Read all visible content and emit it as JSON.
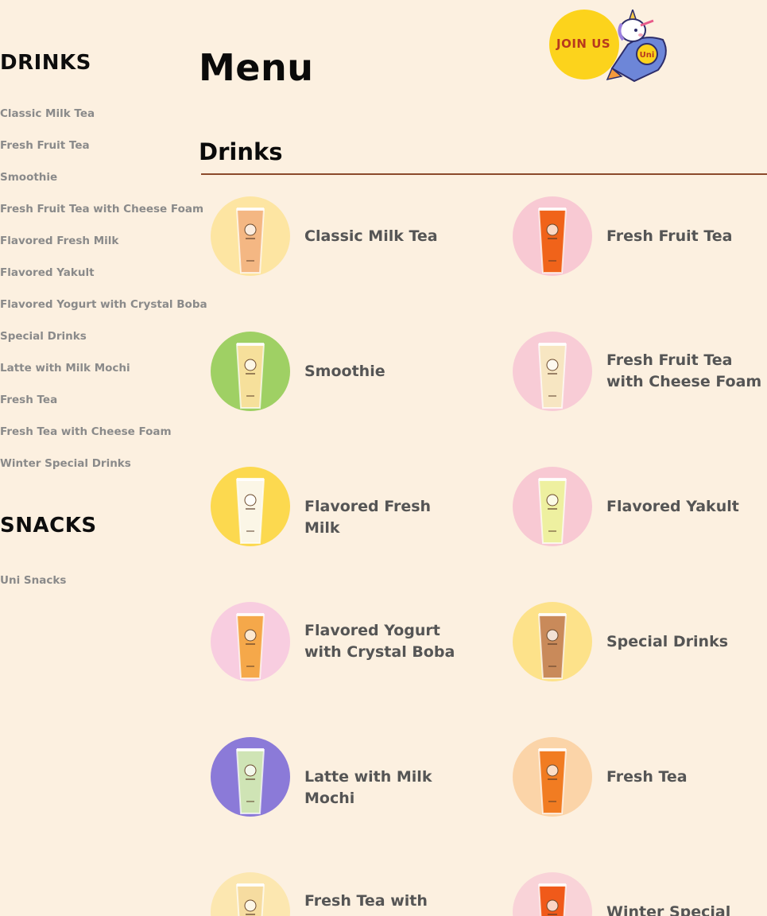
{
  "sidebar": {
    "drinks_heading": "DRINKS",
    "drinks_items": [
      "Classic Milk Tea",
      "Fresh Fruit Tea",
      "Smoothie",
      "Fresh Fruit Tea with Cheese Foam",
      "Flavored Fresh Milk",
      "Flavored Yakult",
      "Flavored Yogurt with Crystal Boba",
      "Special Drinks",
      "Latte with Milk Mochi",
      "Fresh Tea",
      "Fresh Tea with Cheese Foam",
      "Winter Special Drinks"
    ],
    "snacks_heading": "SNACKS",
    "snacks_items": [
      "Uni Snacks"
    ]
  },
  "header": {
    "title": "Menu",
    "join_label": "JOIN US",
    "mascot_badge": "Uni"
  },
  "section": {
    "title": "Drinks"
  },
  "menu_items": [
    {
      "label": "Classic Milk Tea",
      "bg": "#fde5a2",
      "drink": "#f4b783"
    },
    {
      "label": "Fresh Fruit Tea",
      "bg": "#f8c9d3",
      "drink": "#f0631a"
    },
    {
      "label": "Smoothie",
      "bg": "#9fd064",
      "drink": "#f6e09b"
    },
    {
      "label": "Fresh Fruit Tea with Cheese Foam",
      "bg": "#f8ccd6",
      "drink": "#f7e6c2"
    },
    {
      "label": "Flavored Fresh Milk",
      "bg": "#fcd94f",
      "drink": "#fbf6e6"
    },
    {
      "label": "Flavored Yakult",
      "bg": "#f8c9d3",
      "drink": "#eef0a0"
    },
    {
      "label": "Flavored Yogurt with Crystal Boba",
      "bg": "#f8cde0",
      "drink": "#f5a84a"
    },
    {
      "label": "Special Drinks",
      "bg": "#fde28a",
      "drink": "#c98a5a"
    },
    {
      "label": "Latte with Milk Mochi",
      "bg": "#8b7ad8",
      "drink": "#cfe4b5"
    },
    {
      "label": "Fresh Tea",
      "bg": "#fbd4a8",
      "drink": "#f17c22"
    },
    {
      "label": "Fresh Tea with Cheese Foam",
      "bg": "#fce7b0",
      "drink": "#f6dca0"
    },
    {
      "label": "Winter Special Drinks",
      "bg": "#f9d3d8",
      "drink": "#f05a1a"
    }
  ],
  "colors": {
    "background": "#fcf0e0",
    "rule": "#8b4a2b",
    "join_yellow": "#fcd31c",
    "join_text": "#b8391d"
  }
}
